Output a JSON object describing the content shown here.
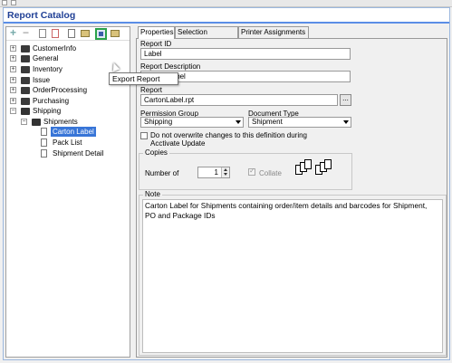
{
  "window": {
    "title": "Report Catalog"
  },
  "toolbar": {
    "tooltip": "Export Report"
  },
  "tree": [
    {
      "label": "CustomerInfo",
      "expander": "+",
      "icon": "folder-icon"
    },
    {
      "label": "General",
      "expander": "+",
      "icon": "folder-icon"
    },
    {
      "label": "Inventory",
      "expander": "+",
      "icon": "folder-icon"
    },
    {
      "label": "Issue",
      "expander": "+",
      "icon": "folder-icon"
    },
    {
      "label": "OrderProcessing",
      "expander": "+",
      "icon": "folder-icon"
    },
    {
      "label": "Purchasing",
      "expander": "+",
      "icon": "folder-icon"
    },
    {
      "label": "Shipping",
      "expander": "−",
      "icon": "folder-open-icon"
    },
    {
      "label": "Shipments",
      "expander": "−",
      "icon": "folder-open-icon"
    },
    {
      "label": "Carton Label",
      "icon": "report-page-icon",
      "selected": true
    },
    {
      "label": "Pack List",
      "icon": "report-page-icon"
    },
    {
      "label": "Shipment Detail",
      "icon": "report-page-icon"
    }
  ],
  "tabs": [
    "Properties",
    "Selection Prompts",
    "Printer Assignments"
  ],
  "form": {
    "report_id_label": "Report ID",
    "report_id_value": "Label",
    "description_label": "Report Description",
    "description_value": "Carton Label",
    "report_label": "Report",
    "report_value": "CartonLabel.rpt",
    "browse_label": "...",
    "permission_group_label": "Permission Group",
    "permission_group_value": "Shipping",
    "document_type_label": "Document Type",
    "document_type_value": "Shipment",
    "no_overwrite_label_1": "Do not overwrite changes to this definition during",
    "no_overwrite_label_2": "Acctivate Update",
    "copies_group": "Copies",
    "number_of_label": "Number of",
    "number_of_value": "1",
    "collate_label": "Collate",
    "note_group": "Note",
    "note_text": "Carton Label for Shipments containing order/item details and barcodes for Shipment, PO and Package IDs"
  },
  "colors": {
    "accent": "#1f3f95",
    "title_border": "#5b8ee6",
    "selection": "#3875d7",
    "highlight": "#2aa24a"
  }
}
